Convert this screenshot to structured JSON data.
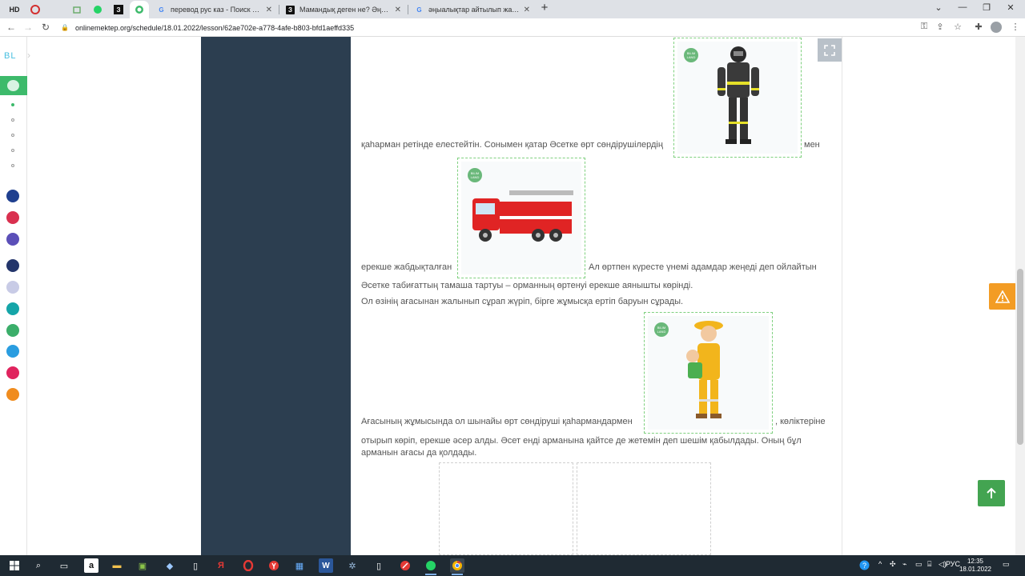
{
  "browser": {
    "pinned_tabs": [
      {
        "label": "HD",
        "icon": "hd-icon"
      },
      {
        "label": "",
        "icon": "opera-icon"
      },
      {
        "label": "",
        "icon": "blank-icon"
      },
      {
        "label": "",
        "icon": "puzzle-icon"
      },
      {
        "label": "",
        "icon": "whatsapp-icon"
      },
      {
        "label": "З",
        "icon": "z-icon"
      }
    ],
    "tabs": [
      {
        "title": "перевод рус каз - Поиск в Goog…",
        "favicon": "G"
      },
      {
        "title": "Мамандық деген не? Әңгімеде…",
        "favicon": "З"
      },
      {
        "title": "әңыалықтар айтылып жатыр. Кер…",
        "favicon": "G"
      }
    ],
    "new_tab": "+",
    "url": "onlinemektep.org/schedule/18.01.2022/lesson/62ae702e-a778-4afe-b803-bfd1aeffd335"
  },
  "sidebar": {
    "logo": "BL"
  },
  "content": {
    "line1_text": "қаһарман ретінде елестейтін. Сонымен қатар Әсетке өрт сөндірушілердің",
    "line1_tail": "мен",
    "line2_text": "ерекше жабдықталған",
    "line2_tail": "Ал өртпен күресте үнемі адамдар жеңеді деп ойлайтын",
    "line3": "Әсетке табиғаттың тамаша тартуы – орманның өртенуі ерекше аянышты көрінді.",
    "line4": "Ол өзінің ағасынан жалынып сұрап жүріп, бірге жұмысқа ертіп баруын сұрады.",
    "line5_text": "Ағасының жұмысында ол шынайы өрт сөндіруші қаһармандармен",
    "line5_tail": ", көліктеріне",
    "line6": "отырып көріп, ерекше әсер алды. Әсет енді арманына қайтсе де жетемін деп шешім қабылдады. Оның бұл арманын ағасы да қолдады.",
    "badge": "BILIM LAND"
  },
  "system": {
    "lang": "РУС",
    "time": "12:35",
    "date": "18.01.2022"
  }
}
